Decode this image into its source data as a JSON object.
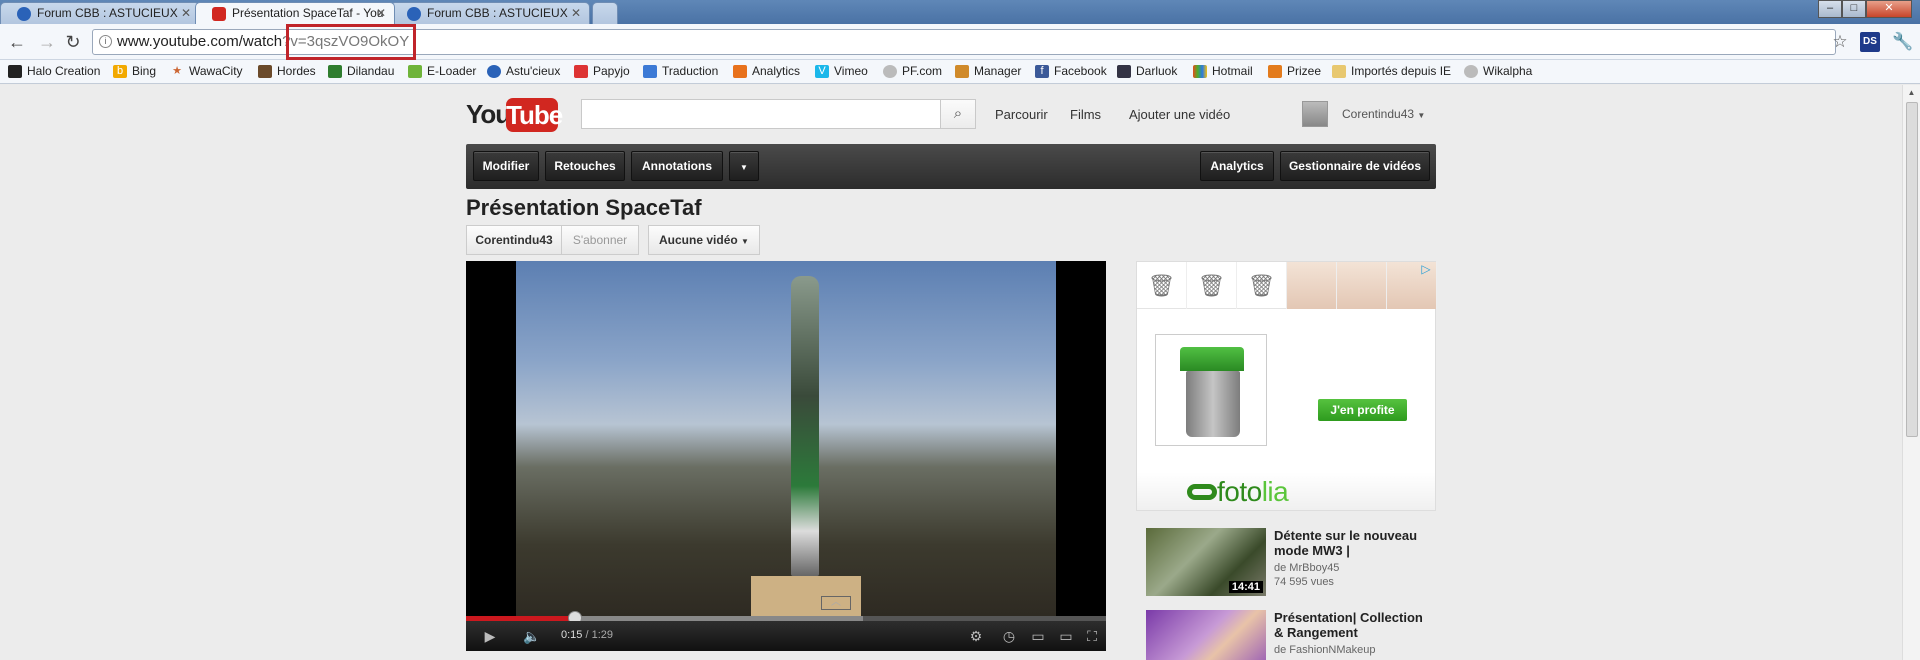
{
  "browser": {
    "tabs": [
      {
        "label": "Forum CBB : ASTUCIEUX",
        "active": false
      },
      {
        "label": "Présentation SpaceTaf - You",
        "active": true
      },
      {
        "label": "Forum CBB : ASTUCIEUX",
        "active": false
      }
    ],
    "url_host": "www.youtube.com/watch",
    "url_tail": "?v=3qszVO9OkOY",
    "bookmarks": [
      "Halo Creation",
      "Bing",
      "WawaCity",
      "Hordes",
      "Dilandau",
      "E-Loader",
      "Astu'cieux",
      "Papyjo",
      "Traduction",
      "Analytics",
      "Vimeo",
      "PF.com",
      "Manager",
      "Facebook",
      "Darluok",
      "Hotmail",
      "Prizee",
      "Importés depuis IE",
      "Wikalpha"
    ]
  },
  "header": {
    "logo_you": "You",
    "logo_tube": "Tube",
    "links": [
      "Parcourir",
      "Films",
      "Ajouter une vidéo"
    ],
    "username": "Corentindu43"
  },
  "actionbar": {
    "left": [
      "Modifier",
      "Retouches",
      "Annotations"
    ],
    "right": [
      "Analytics",
      "Gestionnaire de vidéos"
    ]
  },
  "video": {
    "title": "Présentation SpaceTaf",
    "channel": "Corentindu43",
    "subscribe": "S'abonner",
    "playlist": "Aucune vidéo",
    "time_current": "0:15",
    "time_total": "/ 1:29",
    "progress_played": 0.17,
    "progress_loaded": 0.62
  },
  "ad": {
    "cta": "J'en profite",
    "brand_a": "foto",
    "brand_b": "lia"
  },
  "related": [
    {
      "title": "Détente sur le nouveau mode MW3 |",
      "author": "de MrBboy45",
      "views": "74 595 vues",
      "duration": "14:41"
    },
    {
      "title": "Présentation| Collection & Rangement",
      "author": "de FashionNMakeup",
      "views": "",
      "duration": ""
    }
  ],
  "colors": {
    "youtube_red": "#d12720",
    "highlight": "#c0242a",
    "cta_green": "#2e9b1e"
  }
}
